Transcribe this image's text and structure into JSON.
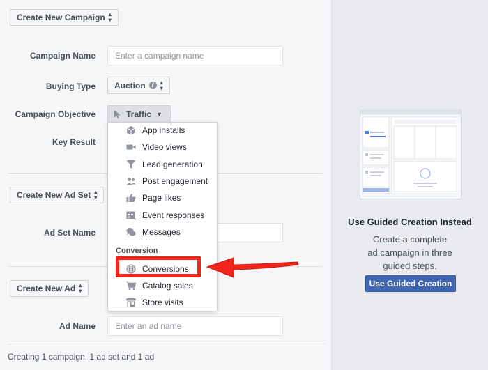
{
  "campaign": {
    "create_button": "Create New Campaign",
    "name_label": "Campaign Name",
    "name_placeholder": "Enter a campaign name",
    "buying_type_label": "Buying Type",
    "buying_type_value": "Auction",
    "objective_label": "Campaign Objective",
    "objective_value": "Traffic",
    "key_result_label": "Key Result"
  },
  "ad_set": {
    "create_button": "Create New Ad Set",
    "name_label": "Ad Set Name"
  },
  "ad": {
    "create_button": "Create New Ad",
    "name_label": "Ad Name",
    "name_placeholder": "Enter an ad name"
  },
  "objective_menu": {
    "items": [
      {
        "label": "App installs",
        "icon": "box-icon"
      },
      {
        "label": "Video views",
        "icon": "video-camera-icon"
      },
      {
        "label": "Lead generation",
        "icon": "funnel-icon"
      },
      {
        "label": "Post engagement",
        "icon": "people-icon"
      },
      {
        "label": "Page likes",
        "icon": "thumbs-up-icon"
      },
      {
        "label": "Event responses",
        "icon": "calendar-icon"
      },
      {
        "label": "Messages",
        "icon": "chat-bubbles-icon"
      }
    ],
    "group_conversion": "Conversion",
    "conversion_items": [
      {
        "label": "Conversions",
        "icon": "globe-icon"
      },
      {
        "label": "Catalog sales",
        "icon": "cart-icon"
      },
      {
        "label": "Store visits",
        "icon": "store-icon"
      }
    ]
  },
  "footer": {
    "status": "Creating 1 campaign, 1 ad set and 1 ad"
  },
  "guided": {
    "title": "Use Guided Creation Instead",
    "description": "Create a complete ad campaign in three guided steps.",
    "button": "Use Guided Creation"
  },
  "colors": {
    "accent": "#4267b2",
    "highlight": "#f0261d"
  }
}
